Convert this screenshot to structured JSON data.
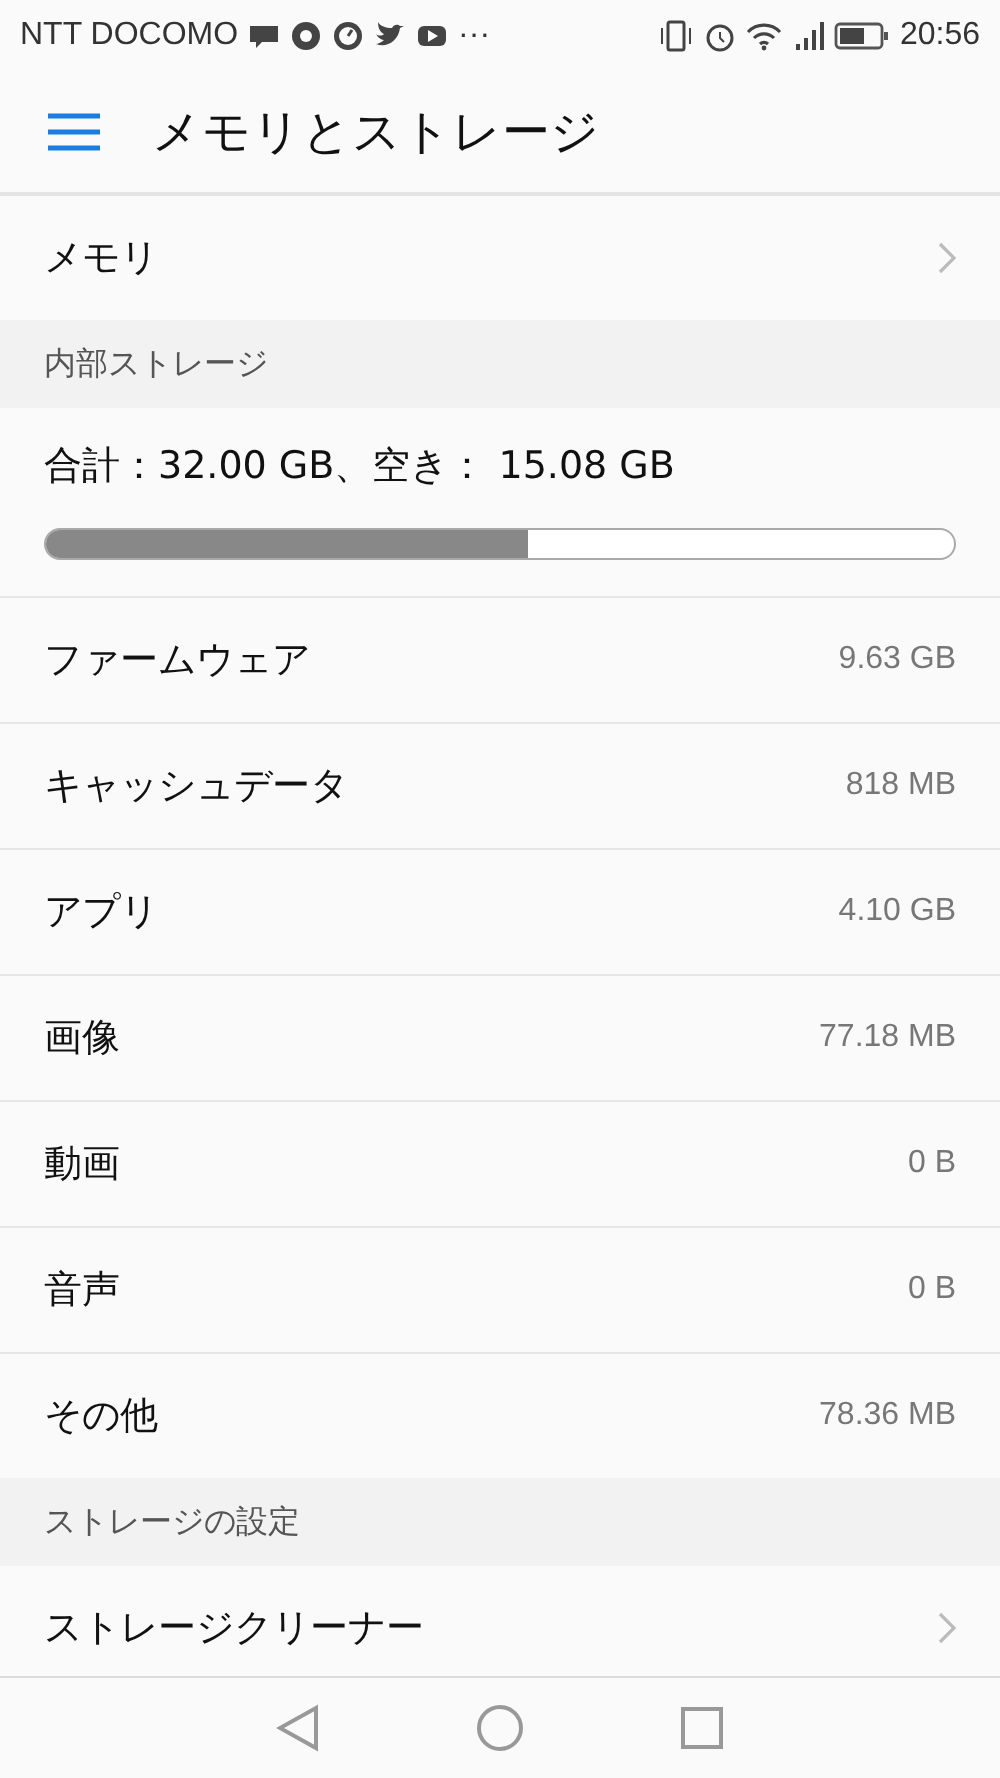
{
  "status_bar": {
    "carrier": "NTT DOCOMO",
    "more": "···",
    "time": "20:56"
  },
  "app_bar": {
    "title": "メモリとストレージ"
  },
  "memory_row": {
    "label": "メモリ"
  },
  "internal": {
    "header": "内部ストレージ",
    "summary": "合計：32.00 GB、空き： 15.08 GB",
    "level": 0.53,
    "items": [
      {
        "label": "ファームウェア",
        "value": "9.63 GB"
      },
      {
        "label": "キャッシュデータ",
        "value": "818 MB"
      },
      {
        "label": "アプリ",
        "value": "4.10 GB"
      },
      {
        "label": "画像",
        "value": "77.18 MB"
      },
      {
        "label": "動画",
        "value": "0 B"
      },
      {
        "label": "音声",
        "value": "0 B"
      },
      {
        "label": "その他",
        "value": "78.36 MB"
      }
    ]
  },
  "settings": {
    "header": "ストレージの設定",
    "items": [
      {
        "label": "ストレージクリーナー"
      }
    ]
  }
}
